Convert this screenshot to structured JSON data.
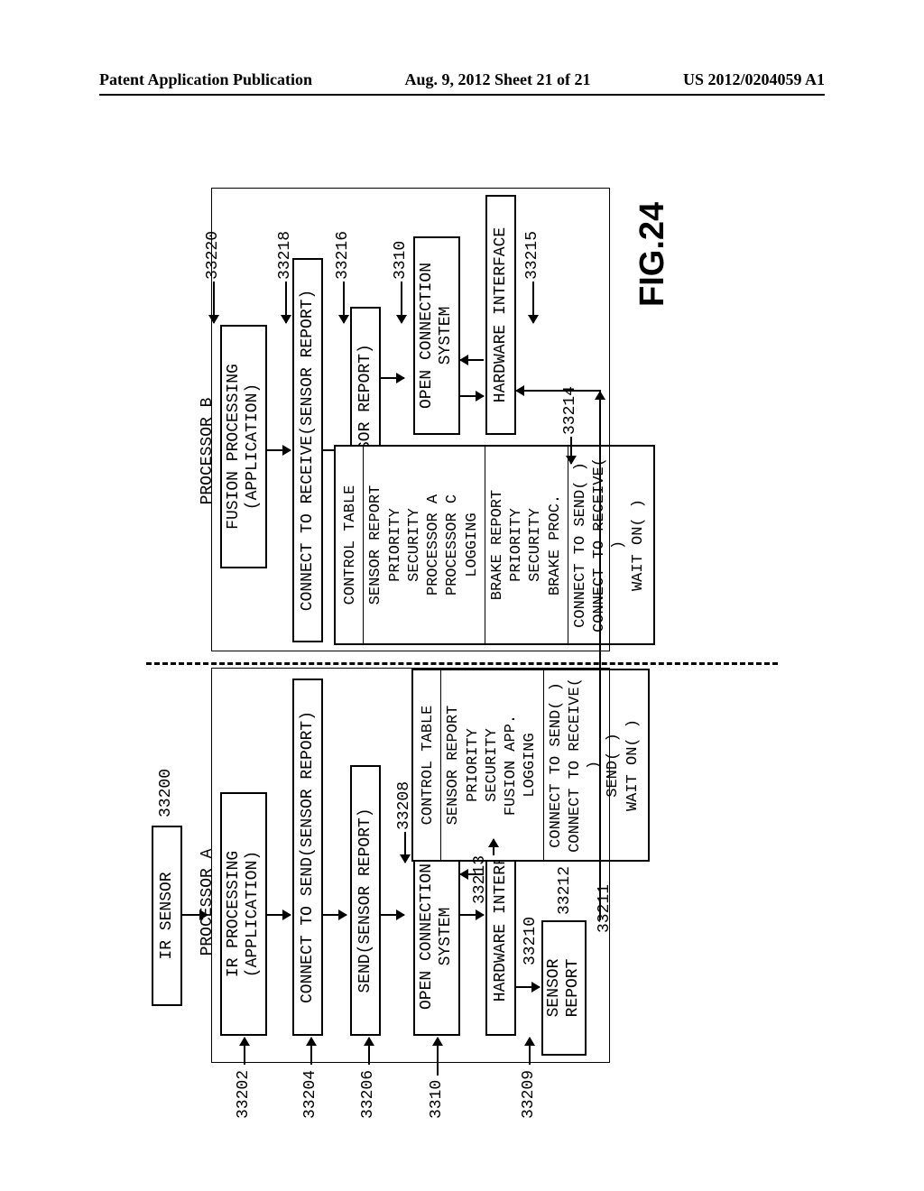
{
  "header": {
    "left": "Patent Application Publication",
    "mid": "Aug. 9, 2012  Sheet 21 of 21",
    "right": "US 2012/0204059 A1"
  },
  "fig_label": "FIG.24",
  "columns": {
    "a_header": "PROCESSOR A",
    "b_header": "PROCESSOR B"
  },
  "left_col": {
    "ir_sensor": "IR SENSOR",
    "ir_proc": "IR PROCESSING\n(APPLICATION)",
    "connect_send": "CONNECT TO SEND(SENSOR REPORT)",
    "send_report": "SEND(SENSOR REPORT)",
    "open_conn": "OPEN CONNECTION\nSYSTEM",
    "hw_iface": "HARDWARE INTERFACE",
    "sensor_report": "SENSOR REPORT"
  },
  "right_col": {
    "fusion_proc": "FUSION PROCESSING\n(APPLICATION)",
    "connect_recv": "CONNECT TO RECEIVE(SENSOR REPORT)",
    "wait_on": "WAIT ON(SENSOR REPORT)",
    "open_conn": "OPEN CONNECTION\nSYSTEM",
    "hw_iface": "HARDWARE INTERFACE"
  },
  "refs": {
    "r33200": "33200",
    "r33202": "33202",
    "r33204": "33204",
    "r33206": "33206",
    "r3310_l": "3310",
    "r33208": "33208",
    "r33209": "33209",
    "r33210": "33210",
    "r33211": "33211",
    "r33212": "33212",
    "r33213": "33213",
    "r33214": "33214",
    "r33215": "33215",
    "r33216": "33216",
    "r33218": "33218",
    "r33220": "33220",
    "r3310_r": "3310"
  },
  "ctable_left": {
    "title": "CONTROL TABLE",
    "group1": {
      "name": "SENSOR REPORT",
      "lines": [
        "PRIORITY",
        "SECURITY",
        "FUSION APP.",
        "LOGGING"
      ]
    },
    "group2": {
      "lines": [
        "CONNECT TO SEND( )",
        "CONNECT TO RECEIVE( )",
        "SEND( )",
        "WAIT ON( )"
      ]
    }
  },
  "ctable_right": {
    "title": "CONTROL TABLE",
    "group1": {
      "name": "SENSOR REPORT",
      "lines": [
        "PRIORITY",
        "SECURITY",
        "PROCESSOR A",
        "PROCESSOR C",
        "LOGGING"
      ]
    },
    "group2": {
      "name": "BRAKE REPORT",
      "lines": [
        "PRIORITY",
        "SECURITY",
        "BRAKE PROC."
      ]
    },
    "group3": {
      "lines": [
        "CONNECT TO SEND( )",
        "CONNECT TO RECEIVE( )",
        "WAIT ON( )"
      ]
    }
  }
}
